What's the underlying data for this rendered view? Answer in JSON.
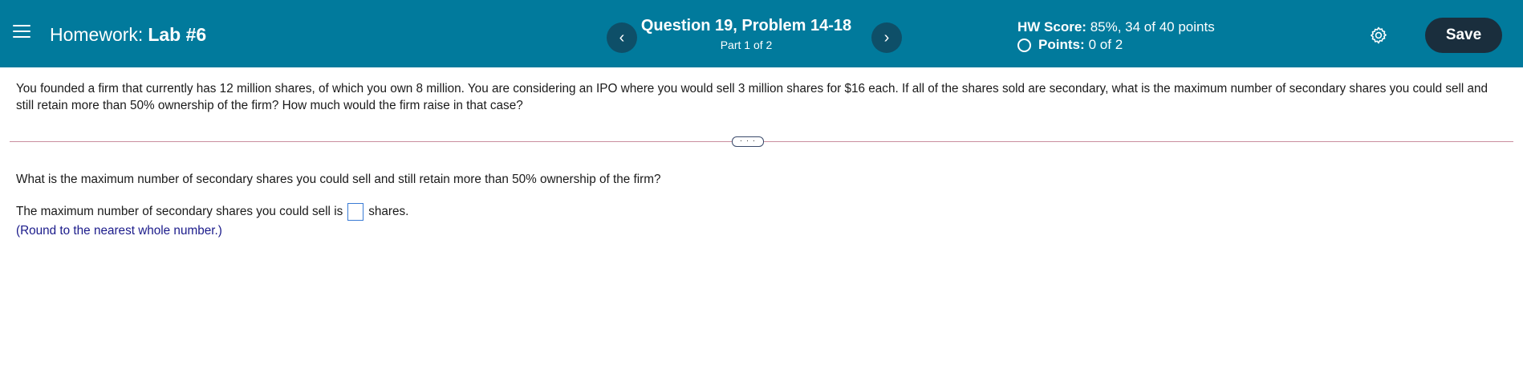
{
  "header": {
    "menu_icon": "hamburger-menu-icon",
    "hw_label": "Homework:",
    "hw_name": "Lab #6",
    "question_title": "Question 19, Problem 14-18",
    "part_label": "Part 1 of 2",
    "prev_icon": "chevron-left-icon",
    "next_icon": "chevron-right-icon",
    "score_label": "HW Score:",
    "score_value": "85%, 34 of 40 points",
    "points_label": "Points:",
    "points_value": "0 of 2",
    "settings_icon": "gear-icon",
    "save_label": "Save",
    "colors": {
      "bar": "#017a9c",
      "nav_button": "#0e4f68",
      "save_button": "#1a2e3d"
    }
  },
  "problem": {
    "text": "You founded a firm that currently has 12 million shares, of which you own 8 million. You are considering an IPO where you would sell 3 million shares for $16 each. If all of the shares sold are secondary, what is the maximum number of secondary shares you could sell and still retain more than 50% ownership of the firm? How much would the firm raise in that case?",
    "expand_label": "· · ·"
  },
  "question": {
    "prompt": "What is the maximum number of secondary shares you could sell and still retain more than 50% ownership of the firm?",
    "answer_prefix": "The maximum number of secondary shares you could sell is",
    "answer_value": "",
    "answer_suffix": "shares.",
    "hint": "(Round to the nearest whole number.)"
  }
}
